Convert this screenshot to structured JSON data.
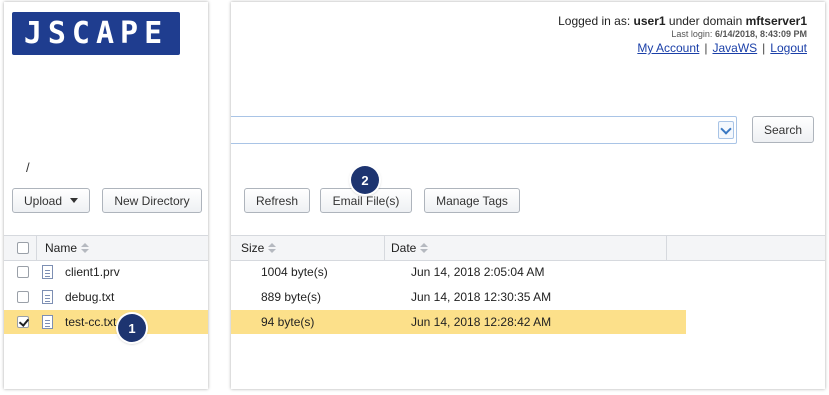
{
  "brand": {
    "logo_text": "JSCAPE",
    "color": "#1f3d8f"
  },
  "user_info": {
    "prefix": "Logged in as:",
    "user": "user1",
    "under_text": "under domain",
    "domain": "mftserver1",
    "last_login_label": "Last login:",
    "last_login_value": "6/14/2018, 8:43:09 PM",
    "links": {
      "my_account": "My Account",
      "javaws": "JavaWS",
      "logout": "Logout"
    },
    "separator": "|"
  },
  "search": {
    "value": "",
    "placeholder": "",
    "button_label": "Search"
  },
  "breadcrumb": {
    "path": "/"
  },
  "toolbar": {
    "upload_label": "Upload",
    "new_directory_label": "New Directory",
    "refresh_label": "Refresh",
    "email_files_label": "Email File(s)",
    "manage_tags_label": "Manage Tags"
  },
  "table": {
    "columns": {
      "name": "Name",
      "size": "Size",
      "date": "Date"
    },
    "rows": [
      {
        "name": "client1.prv",
        "size": "1004 byte(s)",
        "date": "Jun 14, 2018 2:05:04 AM",
        "checked": false,
        "selected": false
      },
      {
        "name": "debug.txt",
        "size": "889 byte(s)",
        "date": "Jun 14, 2018 12:30:35 AM",
        "checked": false,
        "selected": false
      },
      {
        "name": "test-cc.txt",
        "size": "94 byte(s)",
        "date": "Jun 14, 2018 12:28:42 AM",
        "checked": true,
        "selected": true
      }
    ]
  },
  "callouts": {
    "badge1": "1",
    "badge2": "2"
  },
  "colors": {
    "selected_row": "#fce08a",
    "badge": "#1d3470",
    "link": "#1a3fa8"
  },
  "icons": [
    "file-icon",
    "sort-icon",
    "checkbox-icon",
    "chevron-down-icon",
    "caret-down-icon"
  ]
}
